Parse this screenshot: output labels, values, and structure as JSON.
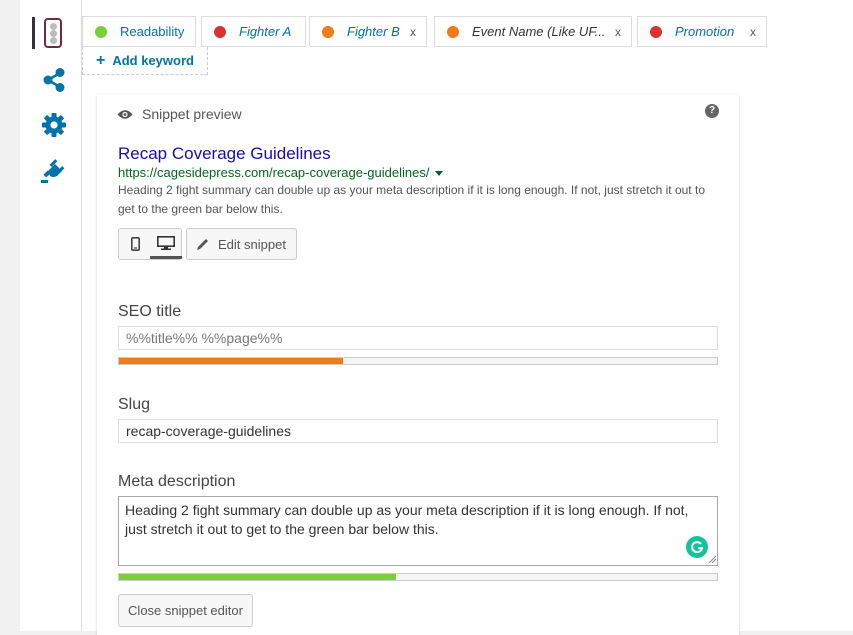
{
  "colors": {
    "link_blue": "#0073aa",
    "good_green": "#7ad03a",
    "ok_orange": "#ee7c1b",
    "bad_red": "#dc3232",
    "serp_title": "#1a0dab",
    "serp_url": "#006621",
    "grammarly": "#15c39a"
  },
  "sidebar": {
    "items": [
      {
        "icon": "traffic-light-icon"
      },
      {
        "icon": "share-icon"
      },
      {
        "icon": "gear-icon"
      },
      {
        "icon": "plug-icon"
      }
    ]
  },
  "tabs": [
    {
      "label": "Readability",
      "status_color": "#7ad03a",
      "closable": false
    },
    {
      "label": "Fighter A",
      "status_color": "#dc3232",
      "closable": false
    },
    {
      "label": "Fighter B",
      "status_color": "#ee7c1b",
      "closable": true
    },
    {
      "label": "Event Name (Like UF...",
      "status_color": "#ee7c1b",
      "closable": true
    },
    {
      "label": "Promotion",
      "status_color": "#dc3232",
      "closable": true
    }
  ],
  "tab_close_glyph": "x",
  "add_keyword": {
    "plus": "+",
    "label": "Add keyword"
  },
  "snippet": {
    "header": "Snippet preview",
    "help_glyph": "?",
    "title": "Recap Coverage Guidelines",
    "url": "https://cagesidepress.com/recap-coverage-guidelines/",
    "description": "Heading 2 fight summary can double up as your meta description if it is long enough. If not, just stretch it out to get to the green bar below this.",
    "edit_label": "Edit snippet"
  },
  "editor": {
    "seo_title_label": "SEO title",
    "seo_title_value": "%%title%% %%page%%",
    "seo_title_progress": 0.375,
    "slug_label": "Slug",
    "slug_value": "recap-coverage-guidelines",
    "meta_label": "Meta description",
    "meta_value": "Heading 2 fight summary can double up as your meta description if it is long enough. If not, just stretch it out to get to the green bar below this.",
    "meta_progress": 0.463,
    "close_label": "Close snippet editor"
  }
}
